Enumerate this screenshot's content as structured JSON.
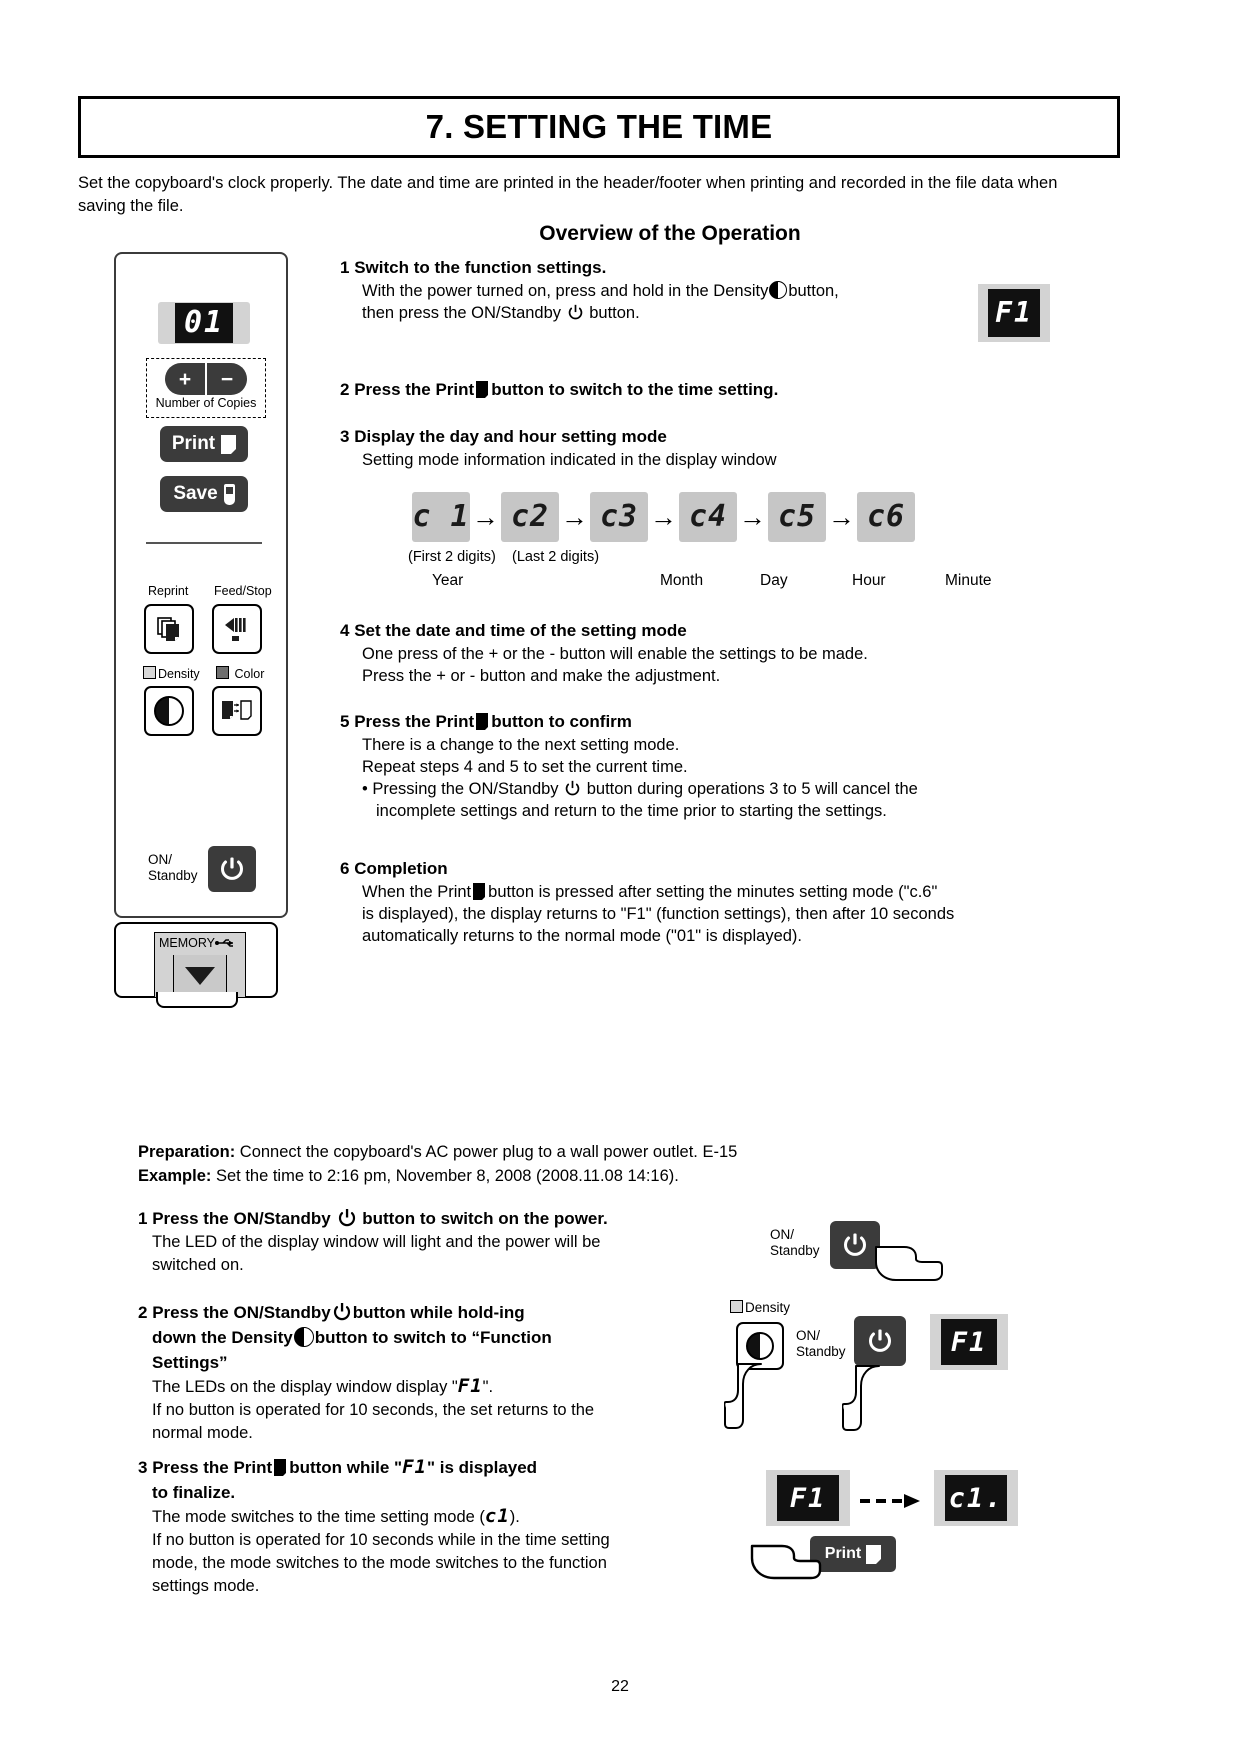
{
  "document": {
    "title": "7. SETTING THE TIME",
    "intro": "Set the copyboard's clock properly. The date and time are printed in the header/footer when printing and recorded in the file data when saving the file.",
    "page_number": "22"
  },
  "device_panel": {
    "display_value": "01",
    "copies_label": "Number of Copies",
    "plus_label": "+",
    "minus_label": "−",
    "print_label": "Print",
    "save_label": "Save",
    "reprint_label": "Reprint",
    "feed_stop_label": "Feed/Stop",
    "density_label": "Density",
    "color_label": "Color",
    "onstandby_line1": "ON/",
    "onstandby_line2": "Standby",
    "memory_label": "MEMORY"
  },
  "overview": {
    "heading": "Overview of the Operation",
    "badge_f1": "F1",
    "steps": [
      {
        "num": "1",
        "head": "Switch to the function settings.",
        "body_1a": "With the power turned on, press and hold in the Density",
        "body_1b": "button,",
        "body_2a": "then press the ON/Standby",
        "body_2b": "button."
      },
      {
        "num": "2",
        "head_a": "Press the Print",
        "head_b": "button to switch to the time setting."
      },
      {
        "num": "3",
        "head": "Display the day and hour setting mode",
        "body": "Setting mode information indicated in the display window"
      },
      {
        "num": "4",
        "head": "Set the date and time of the setting mode",
        "body_1": "One press of the + or the - button will enable the settings to be made.",
        "body_2": "Press the + or - button and make the adjustment."
      },
      {
        "num": "5",
        "head_a": "Press the Print",
        "head_b": "button to confirm",
        "body_1": "There is a change to the next setting mode.",
        "body_2": "Repeat steps 4 and 5 to set the current time.",
        "body_3a": "• Pressing the ON/Standby",
        "body_3b": "button during operations 3 to 5 will cancel the",
        "body_4": "incomplete settings and return to the time prior to starting the settings."
      },
      {
        "num": "6",
        "head": "Completion",
        "body_1a": "When the Print",
        "body_1b": "button is pressed after setting the minutes setting mode (\"c.6\"",
        "body_2": "is displayed), the display returns to \"F1\" (function settings), then after 10 seconds",
        "body_3": "automatically returns to the normal mode (\"01\" is displayed)."
      }
    ]
  },
  "mode_sequence": {
    "chips": [
      "c 1",
      "c2",
      "c3",
      "c4",
      "c5",
      "c6"
    ],
    "arrow": "→",
    "note_first": "(First 2 digits)",
    "note_last": "(Last 2 digits)",
    "unit_year": "Year",
    "unit_month": "Month",
    "unit_day": "Day",
    "unit_hour": "Hour",
    "unit_minute": "Minute"
  },
  "preparation": {
    "prep_label": "Preparation:",
    "prep_text": "Connect the copyboard's AC power plug to a wall power outlet. E-15",
    "example_label": "Example:",
    "example_text": "Set the time to 2:16 pm, November 8, 2008 (2008.11.08 14:16)."
  },
  "bottom_steps": [
    {
      "num": "1",
      "head_a": "Press the ON/Standby",
      "head_b": "button to switch on the power.",
      "body_1": "The LED of the display window will light and the power will be",
      "body_2": "switched on."
    },
    {
      "num": "2",
      "head_a": "Press the ON/Standby",
      "head_b": "button while hold-ing",
      "head_c": "down the Density",
      "head_d": "button to switch to “Function",
      "head_e": "Settings”",
      "body_1a": "The LEDs on the display window display \"",
      "body_1b": "F1",
      "body_1c": "\".",
      "body_2": "If no button is operated for 10 seconds, the set returns to the",
      "body_3": "normal mode."
    },
    {
      "num": "3",
      "head_a": "Press the Print",
      "head_b": "button while \"",
      "head_c": "F1",
      "head_d": "\" is displayed",
      "head_e": "to finalize.",
      "body_1a": "The mode switches to the time setting mode (",
      "body_1b": "c1",
      "body_1c": ").",
      "body_2": "If no button is operated for 10 seconds while in the time setting",
      "body_3": "mode, the mode switches to the mode switches to the function",
      "body_4": "settings mode."
    }
  ],
  "bottom_illustrations": {
    "step1_on": "ON/",
    "step1_standby": "Standby",
    "step2_density": "Density",
    "step2_on": "ON/",
    "step2_standby": "Standby",
    "step2_badge": "F1",
    "step3_badge_from": "F1",
    "step3_badge_to": "c1.",
    "step3_print": "Print"
  },
  "colors": {
    "dark_button": "#3b3b3b",
    "led_bezel": "#d3d3d3",
    "led_screen": "#111111",
    "chip_gray": "#c6c6c6"
  }
}
